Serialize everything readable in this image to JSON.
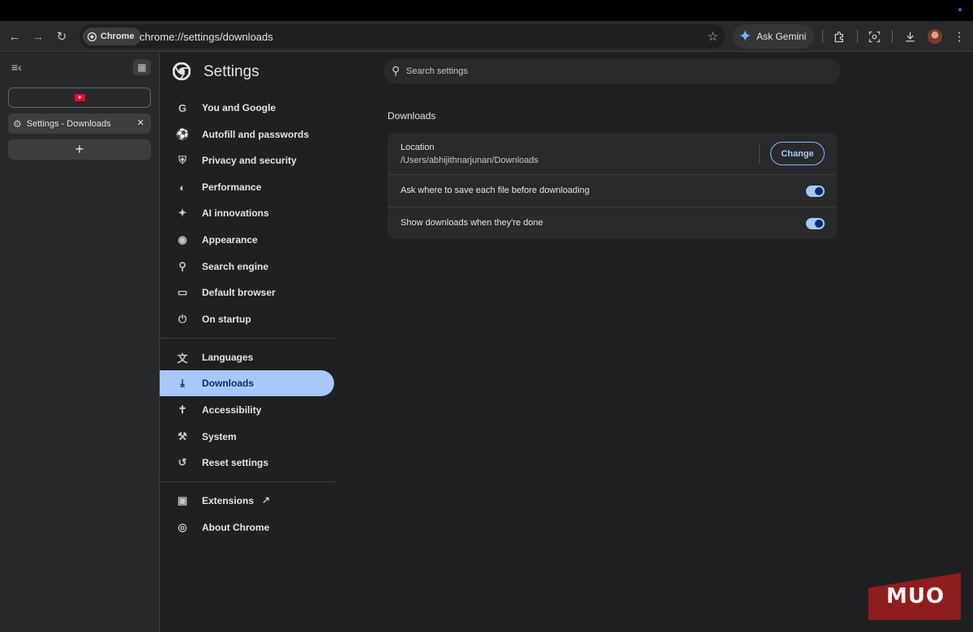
{
  "browser": {
    "chip_label": "Chrome",
    "url": "chrome://settings/downloads",
    "gemini_label": "Ask Gemini"
  },
  "side_panel": {
    "tabs": [
      {
        "title": "",
        "icon": "youtube-icon"
      },
      {
        "title": "Settings - Downloads",
        "icon": "gear-icon"
      }
    ],
    "new_tab_label": "+"
  },
  "settings": {
    "title": "Settings",
    "search_placeholder": "Search settings",
    "nav": [
      {
        "label": "You and Google",
        "icon": "google-icon"
      },
      {
        "label": "Autofill and passwords",
        "icon": "key-icon"
      },
      {
        "label": "Privacy and security",
        "icon": "shield-icon"
      },
      {
        "label": "Performance",
        "icon": "speedometer-icon"
      },
      {
        "label": "AI innovations",
        "icon": "sparkle-icon"
      },
      {
        "label": "Appearance",
        "icon": "palette-icon"
      },
      {
        "label": "Search engine",
        "icon": "search-icon"
      },
      {
        "label": "Default browser",
        "icon": "browser-window-icon"
      },
      {
        "label": "On startup",
        "icon": "power-icon"
      },
      {
        "label": "Languages",
        "icon": "translate-icon"
      },
      {
        "label": "Downloads",
        "icon": "download-icon"
      },
      {
        "label": "Accessibility",
        "icon": "accessibility-icon"
      },
      {
        "label": "System",
        "icon": "wrench-icon"
      },
      {
        "label": "Reset settings",
        "icon": "reset-icon"
      },
      {
        "label": "Extensions",
        "icon": "puzzle-icon"
      },
      {
        "label": "About Chrome",
        "icon": "chrome-icon"
      }
    ],
    "active_item": "Downloads",
    "section_title": "Downloads",
    "location_label": "Location",
    "location_path": "/Users/abhijithnarjunan/Downloads",
    "change_label": "Change",
    "toggles": [
      {
        "label": "Ask where to save each file before downloading",
        "on": true
      },
      {
        "label": "Show downloads when they're done",
        "on": true
      }
    ]
  },
  "watermark": "MUO",
  "colors": {
    "accent": "#a8c7fa",
    "background": "#1f2021",
    "watermark": "#8f1d1d"
  }
}
